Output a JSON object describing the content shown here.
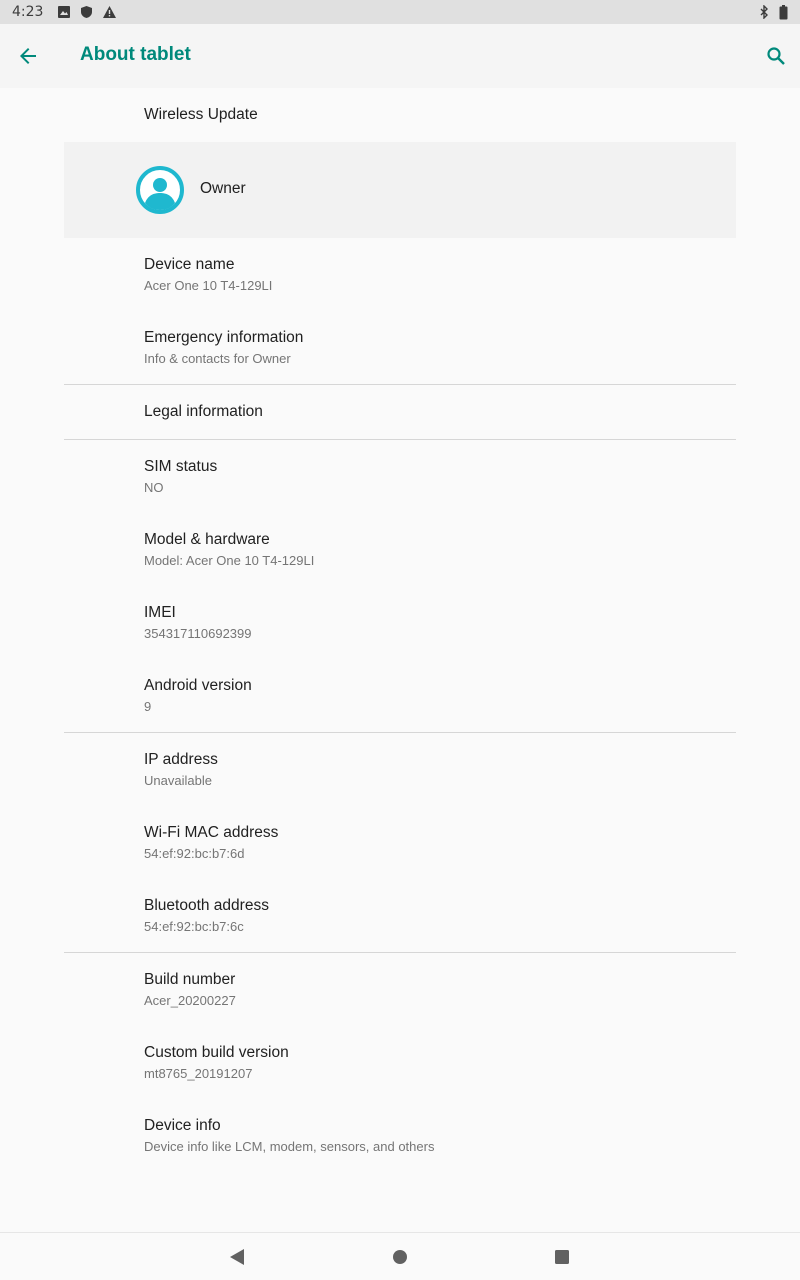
{
  "status_bar": {
    "time": "4:23",
    "icons": [
      "image-icon",
      "shield-icon",
      "warning-icon",
      "bluetooth-icon",
      "battery-icon"
    ]
  },
  "app_bar": {
    "title": "About tablet",
    "accent_color": "#00897b"
  },
  "wireless_update": {
    "title": "Wireless Update"
  },
  "owner": {
    "name": "Owner",
    "avatar_color": "#1fb8cf"
  },
  "items_group1": [
    {
      "title": "Device name",
      "subtitle": "Acer One 10 T4-129LI"
    },
    {
      "title": "Emergency information",
      "subtitle": "Info & contacts for Owner"
    }
  ],
  "legal": {
    "title": "Legal information"
  },
  "items_group2": [
    {
      "title": "SIM status",
      "subtitle": "NO"
    },
    {
      "title": "Model & hardware",
      "subtitle": "Model: Acer One 10 T4-129LI"
    },
    {
      "title": "IMEI",
      "subtitle": "354317110692399"
    },
    {
      "title": "Android version",
      "subtitle": "9"
    }
  ],
  "items_group3": [
    {
      "title": "IP address",
      "subtitle": "Unavailable"
    },
    {
      "title": "Wi-Fi MAC address",
      "subtitle": "54:ef:92:bc:b7:6d"
    },
    {
      "title": "Bluetooth address",
      "subtitle": "54:ef:92:bc:b7:6c"
    }
  ],
  "items_group4": [
    {
      "title": "Build number",
      "subtitle": "Acer_20200227"
    },
    {
      "title": "Custom build version",
      "subtitle": "mt8765_20191207"
    },
    {
      "title": "Device info",
      "subtitle": "Device info like LCM, modem, sensors, and others"
    }
  ]
}
